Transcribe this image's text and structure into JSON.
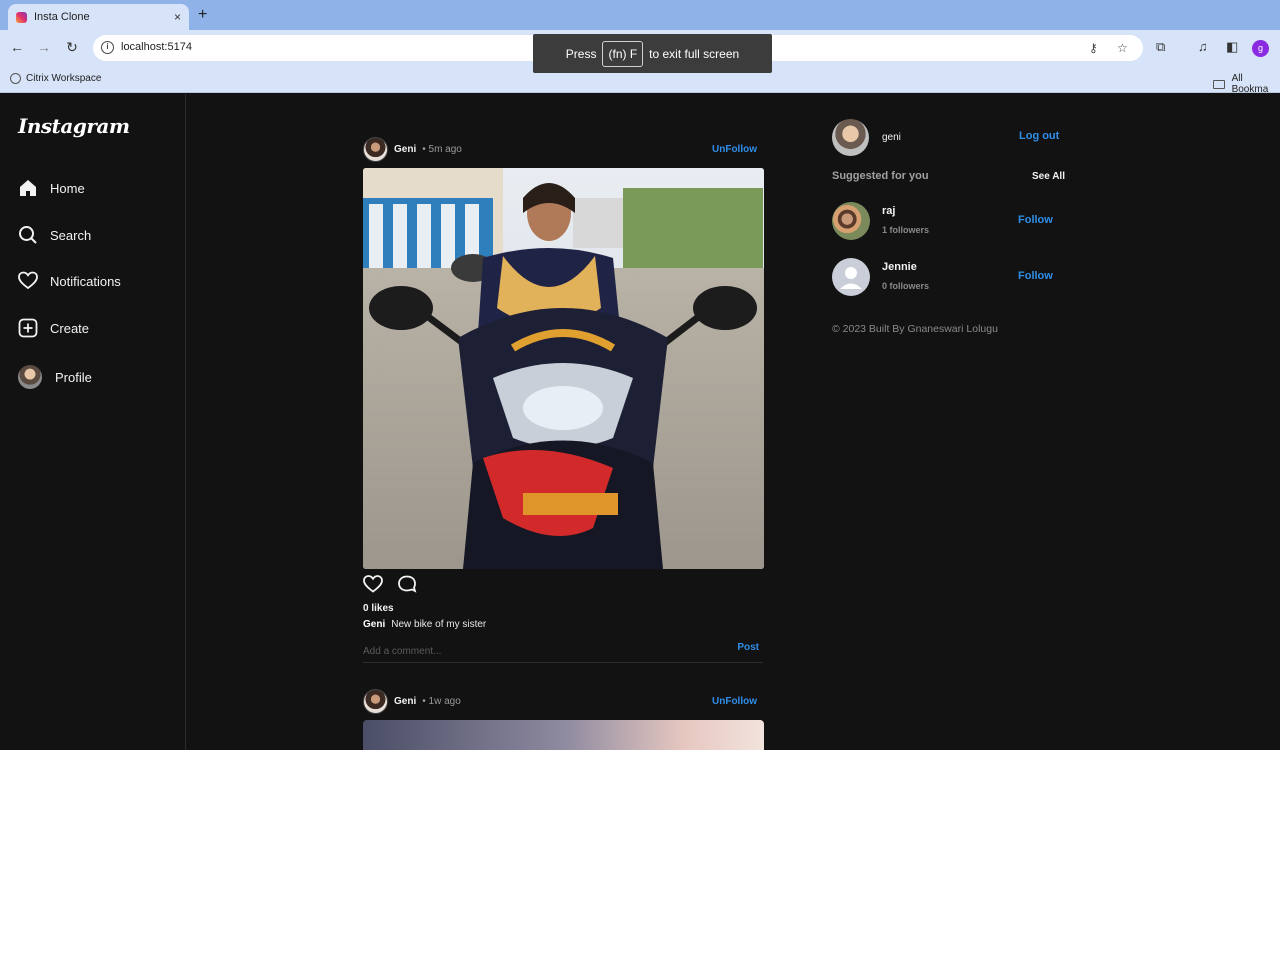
{
  "browser": {
    "tab_title": "Insta Clone",
    "tab_close": "×",
    "new_tab": "+",
    "url": "localhost:5174",
    "bookmark_citrix": "Citrix Workspace",
    "bookmark_all": "All Bookma",
    "profile_initial": "g",
    "fullscreen_press": "Press",
    "fullscreen_key": "(fn) F",
    "fullscreen_msg": "to exit full screen"
  },
  "sidebar": {
    "logo": "Instagram",
    "items": [
      {
        "label": "Home",
        "icon": "home-icon"
      },
      {
        "label": "Search",
        "icon": "search-icon"
      },
      {
        "label": "Notifications",
        "icon": "heart-icon"
      },
      {
        "label": "Create",
        "icon": "plus-square-icon"
      },
      {
        "label": "Profile",
        "icon": "avatar"
      }
    ]
  },
  "posts": [
    {
      "username": "Geni",
      "time": "• 5m ago",
      "unfollow": "UnFollow",
      "likes": "0 likes",
      "caption_user": "Geni",
      "caption_text": "New bike of my sister",
      "comment_placeholder": "Add a comment...",
      "post_label": "Post"
    },
    {
      "username": "Geni",
      "time": "• 1w ago",
      "unfollow": "UnFollow"
    }
  ],
  "right": {
    "me_name": "geni",
    "logout": "Log out",
    "suggested": "Suggested for you",
    "see_all": "See All",
    "suggestions": [
      {
        "name": "raj",
        "followers": "1 followers",
        "follow": "Follow"
      },
      {
        "name": "Jennie",
        "followers": "0 followers",
        "follow": "Follow"
      }
    ],
    "footer": "© 2023 Built By Gnaneswari Lolugu"
  },
  "colors": {
    "accent": "#2f8fe8",
    "background": "#121212"
  }
}
